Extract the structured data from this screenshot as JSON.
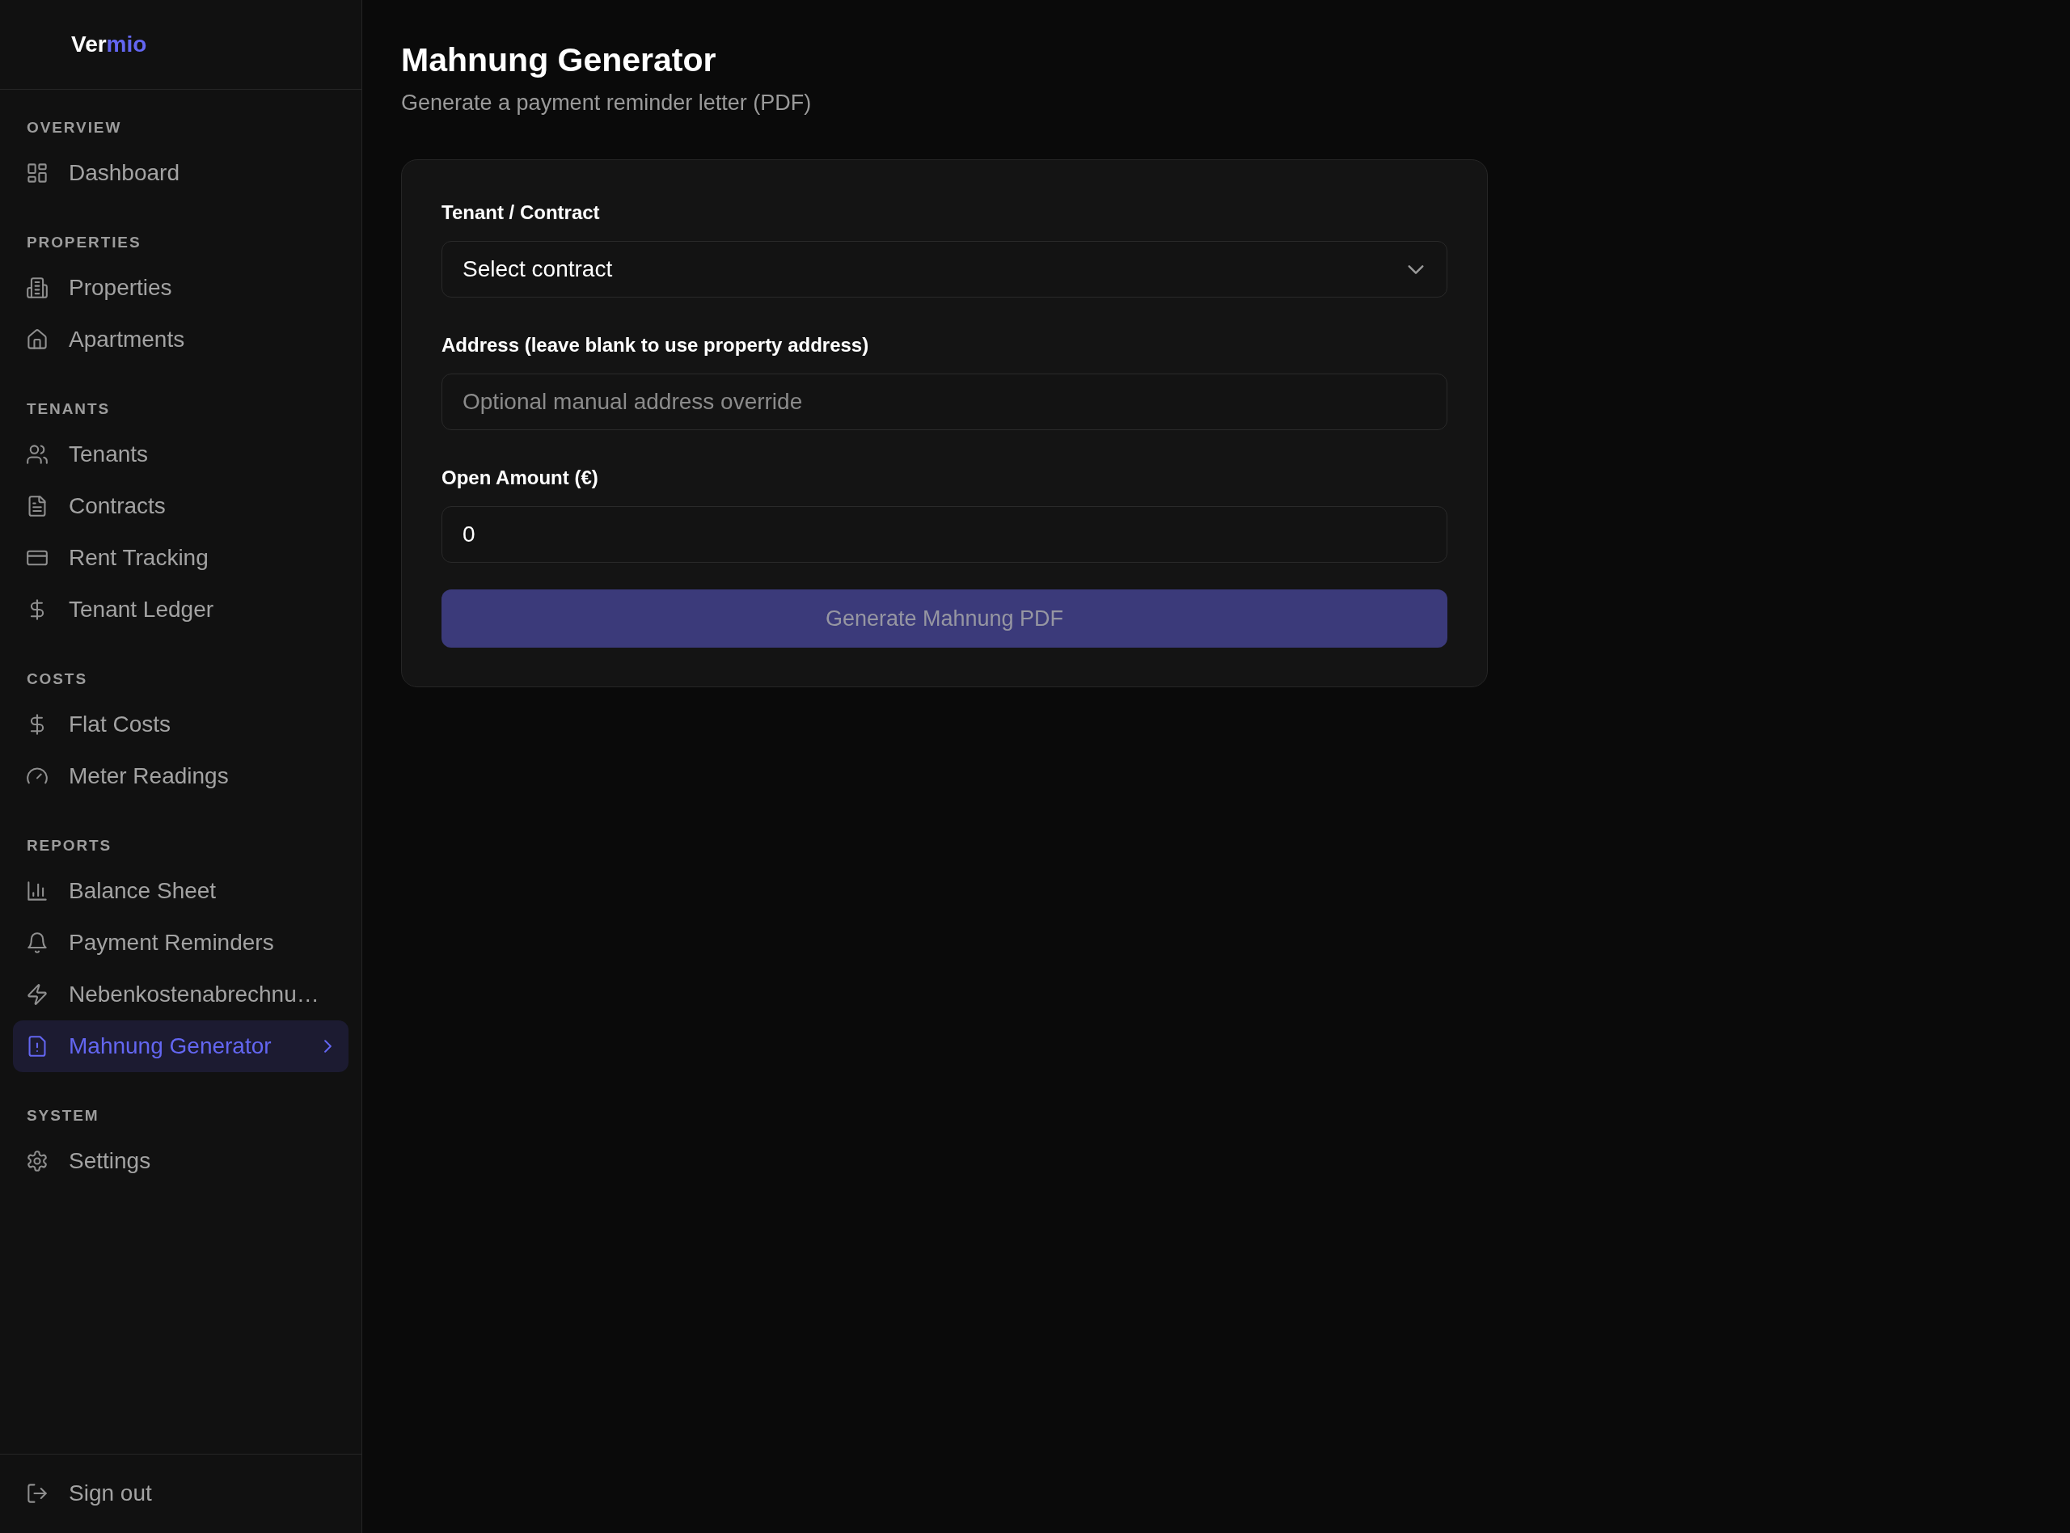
{
  "sidebar": {
    "logo": {
      "lead": "Ver",
      "accent": "mio"
    },
    "sections": [
      {
        "title": "OVERVIEW",
        "items": [
          {
            "label": "Dashboard",
            "selected": false
          }
        ]
      },
      {
        "title": "PROPERTIES",
        "items": [
          {
            "label": "Properties",
            "selected": false
          },
          {
            "label": "Apartments",
            "selected": false
          }
        ]
      },
      {
        "title": "TENANTS",
        "items": [
          {
            "label": "Tenants",
            "selected": false
          },
          {
            "label": "Contracts",
            "selected": false
          },
          {
            "label": "Rent Tracking",
            "selected": false
          },
          {
            "label": "Tenant Ledger",
            "selected": false
          }
        ]
      },
      {
        "title": "COSTS",
        "items": [
          {
            "label": "Flat Costs",
            "selected": false
          },
          {
            "label": "Meter Readings",
            "selected": false
          }
        ]
      },
      {
        "title": "REPORTS",
        "items": [
          {
            "label": "Balance Sheet",
            "selected": false
          },
          {
            "label": "Payment Reminders",
            "selected": false
          },
          {
            "label": "Nebenkostenabrechnu…",
            "selected": false
          },
          {
            "label": "Mahnung Generator",
            "selected": true
          }
        ]
      },
      {
        "title": "SYSTEM",
        "items": [
          {
            "label": "Settings",
            "selected": false
          }
        ]
      }
    ],
    "footer": {
      "label": "Sign out"
    }
  },
  "page": {
    "title": "Mahnung Generator",
    "subtitle": "Generate a payment reminder letter (PDF)"
  },
  "form": {
    "fields": [
      {
        "kind": "select",
        "label": "Tenant / Contract",
        "value": "Select contract"
      },
      {
        "kind": "text",
        "label": "Address (leave blank to use property address)",
        "placeholder": "Optional manual address override"
      },
      {
        "kind": "text",
        "label": "Open Amount (€)",
        "value": "0"
      }
    ],
    "submit": {
      "label": "Generate Mahnung PDF",
      "disabled": true
    }
  }
}
